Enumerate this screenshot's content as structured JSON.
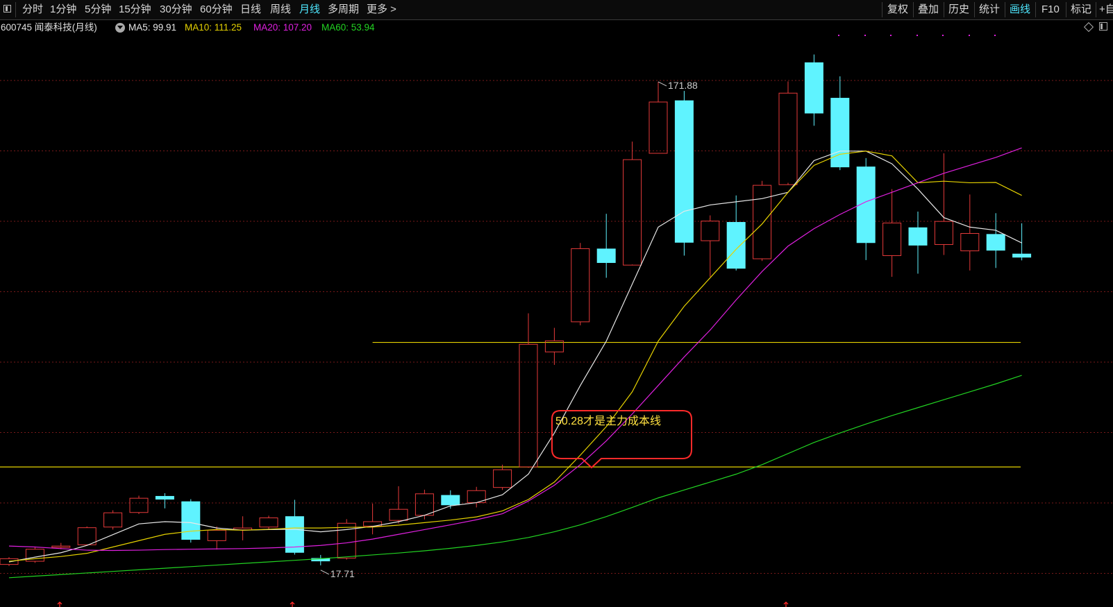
{
  "toolbar": {
    "periods": [
      "分时",
      "1分钟",
      "5分钟",
      "15分钟",
      "30分钟",
      "60分钟",
      "日线",
      "周线",
      "月线",
      "多周期",
      "更多 >"
    ],
    "active_period": "月线",
    "tools": [
      "复权",
      "叠加",
      "历史",
      "统计",
      "画线",
      "F10",
      "标记",
      "+自"
    ],
    "active_tool": "画线"
  },
  "legend": {
    "stock": "600745 闻泰科技(月线)",
    "ma5": "MA5: 99.91",
    "ma10": "MA10: 111.25",
    "ma20": "MA20: 107.20",
    "ma60": "MA60: 53.94"
  },
  "colors": {
    "up": "#e63a3a",
    "down": "#5ff3ff",
    "ma5": "#e8e8e8",
    "ma10": "#e6d200",
    "ma20": "#e020e0",
    "ma60": "#22d422",
    "hline": "#e6d200",
    "grid": "#7a1a1a",
    "annotation_border": "#ff2a2a",
    "annotation_text": "#ffe040",
    "accent": "#4fe8ff"
  },
  "annotation": {
    "text": "50.28才是主力成本线"
  },
  "chart_data": {
    "type": "candlestick",
    "y_range": [
      10,
      185
    ],
    "high_label": "171.88",
    "low_label": "17.71",
    "candles": [
      {
        "o": 19.5,
        "h": 21.8,
        "l": 19.0,
        "c": 21.3
      },
      {
        "o": 20.5,
        "h": 24.9,
        "l": 20.0,
        "c": 24.3
      },
      {
        "o": 25.0,
        "h": 26.3,
        "l": 24.3,
        "c": 25.3
      },
      {
        "o": 25.7,
        "h": 31.5,
        "l": 25.5,
        "c": 31.1
      },
      {
        "o": 31.3,
        "h": 36.6,
        "l": 30.5,
        "c": 35.8
      },
      {
        "o": 35.9,
        "h": 41.2,
        "l": 35.4,
        "c": 40.4
      },
      {
        "o": 41.0,
        "h": 42.0,
        "l": 37.2,
        "c": 40.1
      },
      {
        "o": 39.3,
        "h": 40.1,
        "l": 26.4,
        "c": 27.4
      },
      {
        "o": 27.0,
        "h": 31.5,
        "l": 24.2,
        "c": 30.3
      },
      {
        "o": 30.4,
        "h": 34.7,
        "l": 27.1,
        "c": 31.0
      },
      {
        "o": 31.3,
        "h": 34.9,
        "l": 30.5,
        "c": 34.2
      },
      {
        "o": 34.6,
        "h": 39.9,
        "l": 22.6,
        "c": 23.3
      },
      {
        "o": 21.4,
        "h": 22.5,
        "l": 19.2,
        "c": 20.6
      },
      {
        "o": 21.5,
        "h": 33.8,
        "l": 21.0,
        "c": 32.5
      },
      {
        "o": 31.6,
        "h": 38.7,
        "l": 29.0,
        "c": 33.0
      },
      {
        "o": 33.4,
        "h": 44.2,
        "l": 32.4,
        "c": 36.9
      },
      {
        "o": 35.0,
        "h": 43.1,
        "l": 33.7,
        "c": 41.8
      },
      {
        "o": 41.3,
        "h": 42.9,
        "l": 37.1,
        "c": 38.3
      },
      {
        "o": 39.0,
        "h": 44.0,
        "l": 37.5,
        "c": 42.8
      },
      {
        "o": 43.8,
        "h": 51.0,
        "l": 43.0,
        "c": 49.4
      },
      {
        "o": 50.3,
        "h": 98.8,
        "l": 50.0,
        "c": 89.0
      },
      {
        "o": 86.6,
        "h": 94.2,
        "l": 82.5,
        "c": 90.1
      },
      {
        "o": 96.1,
        "h": 121.0,
        "l": 95.0,
        "c": 119.2
      },
      {
        "o": 119.1,
        "h": 130.2,
        "l": 110.0,
        "c": 114.8
      },
      {
        "o": 114.0,
        "h": 153.0,
        "l": 114.2,
        "c": 147.3
      },
      {
        "o": 149.3,
        "h": 171.88,
        "l": 149.3,
        "c": 165.5
      },
      {
        "o": 165.9,
        "h": 169.0,
        "l": 117.0,
        "c": 121.2
      },
      {
        "o": 121.7,
        "h": 129.7,
        "l": 110.3,
        "c": 127.9
      },
      {
        "o": 127.5,
        "h": 136.0,
        "l": 112.3,
        "c": 113.0
      },
      {
        "o": 116.0,
        "h": 140.6,
        "l": 115.3,
        "c": 139.2
      },
      {
        "o": 139.4,
        "h": 172.0,
        "l": 140.0,
        "c": 168.3
      },
      {
        "o": 177.9,
        "h": 180.5,
        "l": 158.0,
        "c": 162.0
      },
      {
        "o": 166.7,
        "h": 173.6,
        "l": 144.0,
        "c": 145.0
      },
      {
        "o": 145.0,
        "h": 147.8,
        "l": 115.6,
        "c": 121.1
      },
      {
        "o": 117.0,
        "h": 138.0,
        "l": 110.3,
        "c": 127.3
      },
      {
        "o": 125.8,
        "h": 130.9,
        "l": 111.3,
        "c": 120.3
      },
      {
        "o": 120.5,
        "h": 149.3,
        "l": 117.2,
        "c": 127.8
      },
      {
        "o": 118.5,
        "h": 136.3,
        "l": 112.3,
        "c": 124.0
      },
      {
        "o": 123.7,
        "h": 130.4,
        "l": 113.1,
        "c": 118.7
      },
      {
        "o": 117.5,
        "h": 127.2,
        "l": 115.5,
        "c": 116.5
      }
    ],
    "ma5": [
      20.3,
      21.8,
      23.2,
      25.5,
      28.9,
      32.3,
      33.0,
      32.7,
      31.0,
      30.3,
      30.5,
      30.6,
      29.8,
      30.5,
      31.5,
      33.0,
      35.0,
      38.0,
      39.0,
      41.5,
      48.0,
      61.0,
      76.0,
      90.0,
      108.0,
      126.0,
      131.0,
      133.0,
      134.0,
      135.0,
      137.0,
      147.0,
      150.0,
      150.0,
      146.0,
      138.0,
      129.0,
      126.0,
      125.0,
      121.0
    ],
    "ma10": [
      20.5,
      21.3,
      22.0,
      23.0,
      25.0,
      27.0,
      29.0,
      30.0,
      30.5,
      30.3,
      30.6,
      31.0,
      31.0,
      31.2,
      31.3,
      31.9,
      32.7,
      33.5,
      34.5,
      36.4,
      40.0,
      45.5,
      54.0,
      63.0,
      74.0,
      90.0,
      101.0,
      110.0,
      119.0,
      127.0,
      137.0,
      145.5,
      149.0,
      150.0,
      148.5,
      140.0,
      140.5,
      140.0,
      140.1,
      136.0
    ],
    "ma20": [
      25.3,
      25.0,
      24.5,
      24.0,
      23.9,
      24.0,
      24.2,
      24.3,
      24.4,
      24.5,
      24.7,
      25.0,
      25.5,
      26.3,
      27.5,
      29.0,
      30.5,
      32.0,
      33.6,
      35.5,
      39.5,
      44.5,
      51.0,
      58.5,
      67.0,
      76.0,
      85.0,
      93.5,
      103.0,
      112.0,
      120.0,
      125.5,
      130.0,
      134.0,
      137.0,
      140.0,
      143.0,
      145.5,
      148.0,
      151.0
    ],
    "ma60": [
      15.3,
      15.8,
      16.3,
      16.8,
      17.3,
      17.8,
      18.3,
      18.8,
      19.3,
      19.8,
      20.3,
      20.8,
      21.3,
      21.9,
      22.5,
      23.1,
      23.8,
      24.6,
      25.5,
      26.6,
      28.0,
      29.8,
      32.0,
      34.6,
      37.5,
      40.5,
      43.0,
      45.5,
      48.0,
      51.0,
      54.5,
      58.0,
      61.0,
      63.8,
      66.5,
      69.0,
      71.5,
      74.0,
      76.5,
      79.2
    ],
    "horizontal_lines": [
      {
        "value": 89.6,
        "x_start_index": 14
      },
      {
        "value": 50.28,
        "x_start_index": 0
      }
    ]
  }
}
